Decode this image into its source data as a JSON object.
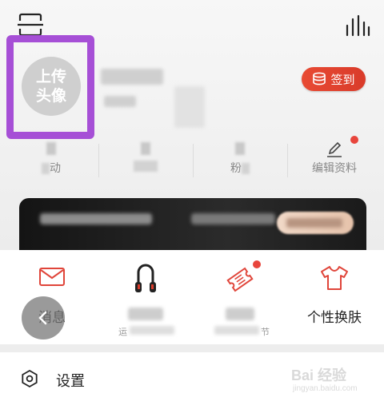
{
  "avatar": {
    "text": "上传\n头像"
  },
  "header": {
    "sign_in_label": "签到"
  },
  "stats": [
    {
      "label_suffix": "动"
    },
    {
      "label_suffix": ""
    },
    {
      "label_prefix": "粉"
    },
    {
      "label": "编辑资料"
    }
  ],
  "shortcuts": [
    {
      "label": "消息",
      "icon": "mail-icon"
    },
    {
      "label": "",
      "sub_prefix": "运",
      "icon": "headphones-icon"
    },
    {
      "label": "",
      "sub_suffix": "节",
      "icon": "ticket-icon"
    },
    {
      "label": "个性换肤",
      "icon": "shirt-icon"
    }
  ],
  "settings": {
    "label": "设置"
  },
  "watermark": {
    "main": "Bai 经验",
    "sub": "jingyan.baidu.com"
  },
  "colors": {
    "accent_red": "#e84a33",
    "highlight_purple": "#a64fd6"
  }
}
